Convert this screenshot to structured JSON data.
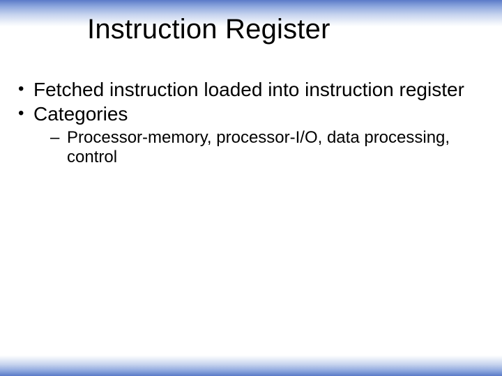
{
  "slide": {
    "title": "Instruction Register",
    "bullets": [
      {
        "text": "Fetched instruction loaded into instruction register"
      },
      {
        "text": "Categories",
        "sub": [
          "Processor-memory, processor-I/O, data processing, control"
        ]
      }
    ]
  }
}
